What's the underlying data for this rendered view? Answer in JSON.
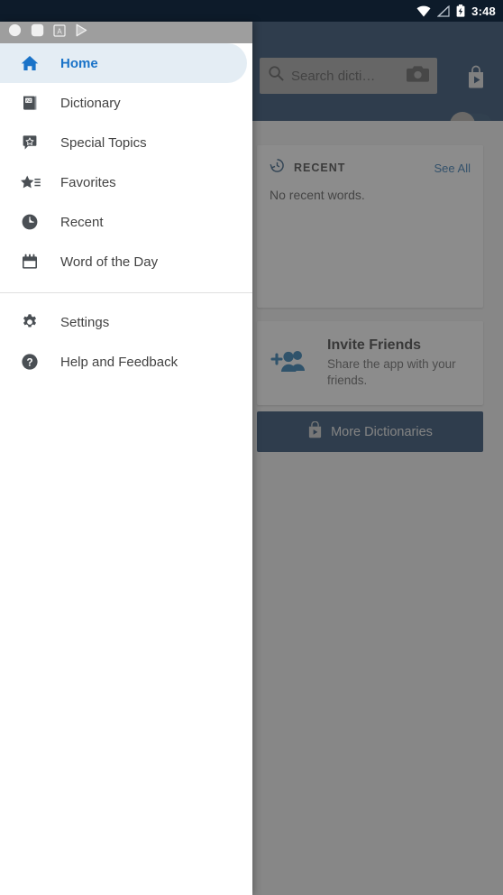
{
  "status_bar": {
    "clock": "3:48",
    "right_icons": [
      "wifi-icon",
      "signal-off-icon",
      "battery-charging-icon"
    ],
    "notification_icons": [
      "circle-notification-icon",
      "rounded-square-notification-icon",
      "letter-a-notification-icon",
      "play-store-notification-icon"
    ]
  },
  "drawer": {
    "items": [
      {
        "label": "Home",
        "icon": "home-icon",
        "selected": true
      },
      {
        "label": "Dictionary",
        "icon": "dictionary-book-icon",
        "selected": false
      },
      {
        "label": "Special Topics",
        "icon": "star-badge-icon",
        "selected": false
      },
      {
        "label": "Favorites",
        "icon": "star-list-icon",
        "selected": false
      },
      {
        "label": "Recent",
        "icon": "clock-icon",
        "selected": false
      },
      {
        "label": "Word of the Day",
        "icon": "calendar-icon",
        "selected": false
      }
    ],
    "footer_items": [
      {
        "label": "Settings",
        "icon": "gear-icon"
      },
      {
        "label": "Help and Feedback",
        "icon": "help-circle-icon"
      }
    ],
    "selected_color": "#1a73c8",
    "selected_background": "#e4edf4"
  },
  "app": {
    "header_color": "#0b3059",
    "search": {
      "placeholder": "Search dicti…",
      "search_icon": "search-icon",
      "camera_icon": "camera-icon"
    },
    "store_button_icon": "play-store-bag-icon",
    "toggle_icon": "fab-toggle",
    "recent_card": {
      "icon": "history-clock-icon",
      "title": "RECENT",
      "action_label": "See All",
      "empty_text": "No recent words.",
      "action_color": "#1565a8"
    },
    "invite_card": {
      "icon": "add-people-icon",
      "title": "Invite Friends",
      "subtitle": "Share the app with your friends."
    },
    "more_dictionaries_button": {
      "icon": "play-store-bag-icon",
      "label": "More Dictionaries"
    }
  }
}
